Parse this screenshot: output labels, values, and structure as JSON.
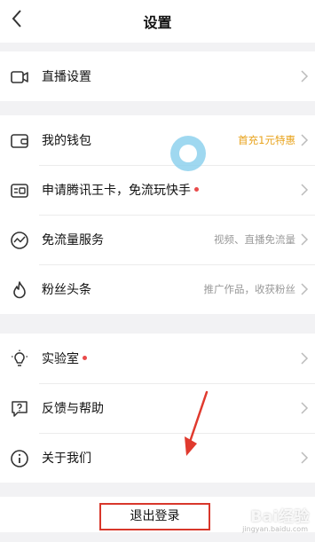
{
  "header": {
    "title": "设置",
    "back_icon": "chevron-left-icon"
  },
  "groups": [
    {
      "items": [
        {
          "label": "直播设置",
          "value": "",
          "icon": "video-camera-icon",
          "dot": false
        }
      ]
    },
    {
      "items": [
        {
          "label": "我的钱包",
          "value": "首充1元特惠",
          "icon": "wallet-icon",
          "dot": false
        },
        {
          "label": "申请腾讯王卡，免流玩快手",
          "value": "",
          "icon": "sim-card-icon",
          "dot": true
        },
        {
          "label": "免流量服务",
          "value": "视频、直播免流量",
          "icon": "data-wave-icon",
          "dot": false
        },
        {
          "label": "粉丝头条",
          "value": "推广作品，收获粉丝",
          "icon": "flame-icon",
          "dot": false
        }
      ]
    },
    {
      "items": [
        {
          "label": "实验室",
          "value": "",
          "icon": "lightbulb-icon",
          "dot": true
        },
        {
          "label": "反馈与帮助",
          "value": "",
          "icon": "help-chat-icon",
          "dot": false
        },
        {
          "label": "关于我们",
          "value": "",
          "icon": "info-icon",
          "dot": false
        }
      ]
    }
  ],
  "logout": {
    "label": "退出登录"
  },
  "watermark": {
    "text": "Bai经验",
    "sub": "jingyan.baidu.com"
  },
  "colors": {
    "promo": "#e8a21a",
    "dot": "#e94b4b",
    "highlight": "#d8372b",
    "touch": "#8fd2ee"
  }
}
